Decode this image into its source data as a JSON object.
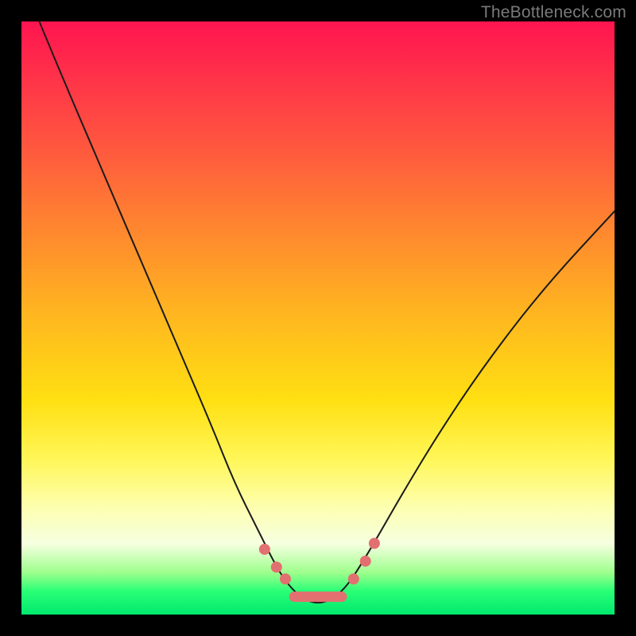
{
  "watermark": "TheBottleneck.com",
  "chart_data": {
    "type": "line",
    "title": "",
    "xlabel": "",
    "ylabel": "",
    "xlim": [
      0,
      100
    ],
    "ylim": [
      0,
      100
    ],
    "grid": false,
    "legend": false,
    "series": [
      {
        "name": "bottleneck-curve",
        "x": [
          3,
          8,
          14,
          20,
          26,
          32,
          36,
          40,
          43,
          45,
          47,
          49,
          51,
          53,
          55,
          57,
          60,
          64,
          70,
          78,
          88,
          100
        ],
        "y": [
          100,
          88,
          74,
          60,
          46,
          32,
          22,
          14,
          8,
          5,
          3,
          2,
          2,
          3,
          5,
          8,
          13,
          20,
          30,
          42,
          55,
          68
        ]
      }
    ],
    "highlight_markers": {
      "name": "trough-markers",
      "color": "#e27070",
      "points": [
        {
          "x": 41,
          "y": 11
        },
        {
          "x": 43,
          "y": 8
        },
        {
          "x": 44.5,
          "y": 6
        },
        {
          "x": 56,
          "y": 6
        },
        {
          "x": 58,
          "y": 9
        },
        {
          "x": 59.5,
          "y": 12
        }
      ],
      "bar": {
        "x_start": 46,
        "x_end": 54,
        "y": 3
      }
    },
    "background_gradient": {
      "top": "#ff1450",
      "mid": "#ffe012",
      "bottom": "#00e86e"
    }
  }
}
